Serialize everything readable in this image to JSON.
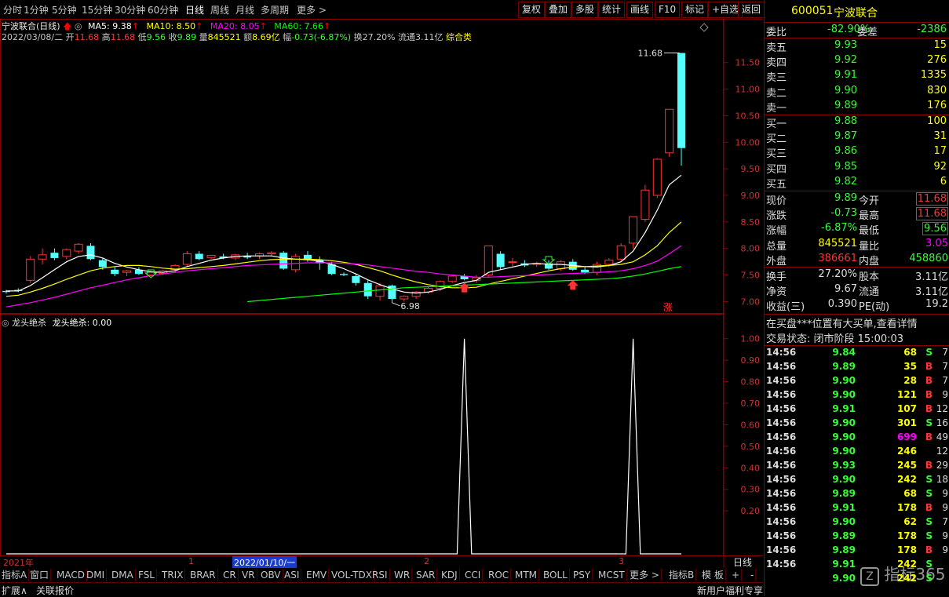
{
  "toolbar": {
    "periods": [
      "分时",
      "1分钟",
      "5分钟",
      "15分钟",
      "30分钟",
      "60分钟",
      "日线",
      "周线",
      "月线",
      "多周期",
      "更多 >"
    ],
    "active_period": "日线",
    "buttons": [
      "复权",
      "叠加",
      "多股",
      "统计",
      "画线",
      "F10",
      "标记",
      "+自选",
      "返回"
    ]
  },
  "header": {
    "stock_title": "宁波联合(日线)",
    "ma5": "MA5: 9.38",
    "ma10": "MA10: 8.50",
    "ma20": "MA20: 8.05",
    "ma60": "MA60: 7.66",
    "date": "2022/03/08/二",
    "open_label": "开",
    "open": "11.68",
    "high_label": "高",
    "high": "11.68",
    "low_label": "低",
    "low": "9.56",
    "close_label": "收",
    "close": "9.89",
    "vol_label": "量",
    "vol": "845521",
    "amt_label": "额",
    "amt": "8.69亿",
    "chg_label": "幅",
    "chg": "-0.73(-6.87%)",
    "turnover": "换27.20%",
    "float": "流通3.11亿",
    "category": "综合类"
  },
  "main_axis": [
    "11.50",
    "11.00",
    "10.50",
    "10.00",
    "9.50",
    "9.00",
    "8.50",
    "8.00",
    "7.50",
    "7.00"
  ],
  "annotations": {
    "high_label": "11.68",
    "low_label": "6.98",
    "zhang": "涨"
  },
  "indicator": {
    "title": "龙头绝杀",
    "value_text": "龙头绝杀: 0.00",
    "axis": [
      "1.00",
      "0.90",
      "0.80",
      "0.70",
      "0.60",
      "0.50",
      "0.40",
      "0.30",
      "0.20"
    ]
  },
  "timeline": {
    "year": "2021年",
    "m1": "1",
    "cursor_date": "2022/01/10/一",
    "m2": "2",
    "m3": "3",
    "period_btn": "日线"
  },
  "bottom_tabs": [
    "指标A",
    "窗口",
    "MACD",
    "DMI",
    "DMA",
    "FSL",
    "TRIX",
    "BRAR",
    "CR",
    "VR",
    "OBV",
    "ASI",
    "EMV",
    "VOL-TDX",
    "RSI",
    "WR",
    "SAR",
    "KDJ",
    "CCI",
    "ROC",
    "MTM",
    "BOLL",
    "PSY",
    "MCST",
    "更多 >"
  ],
  "bottom_right_tabs": [
    "指标B",
    "模 板",
    "+",
    "-"
  ],
  "status": {
    "expand": "扩展∧",
    "related": "关联报价",
    "promo": "新用户福利专享"
  },
  "right": {
    "code": "600051",
    "name": "宁波联合",
    "weibi_label": "委比",
    "weibi": "-82.90%",
    "weicha_label": "委差",
    "weicha": "-2386",
    "sell": [
      {
        "label": "卖五",
        "price": "9.93",
        "vol": "15"
      },
      {
        "label": "卖四",
        "price": "9.92",
        "vol": "276"
      },
      {
        "label": "卖三",
        "price": "9.91",
        "vol": "1335"
      },
      {
        "label": "卖二",
        "price": "9.90",
        "vol": "830"
      },
      {
        "label": "卖一",
        "price": "9.89",
        "vol": "176"
      }
    ],
    "buy": [
      {
        "label": "买一",
        "price": "9.88",
        "vol": "100"
      },
      {
        "label": "买二",
        "price": "9.87",
        "vol": "31"
      },
      {
        "label": "买三",
        "price": "9.86",
        "vol": "17"
      },
      {
        "label": "买四",
        "price": "9.85",
        "vol": "92"
      },
      {
        "label": "买五",
        "price": "9.82",
        "vol": "6"
      }
    ],
    "stats": [
      {
        "l1": "现价",
        "v1": "9.89",
        "l2": "今开",
        "v2": "11.68"
      },
      {
        "l1": "涨跌",
        "v1": "-0.73",
        "l2": "最高",
        "v2": "11.68"
      },
      {
        "l1": "涨幅",
        "v1": "-6.87%",
        "l2": "最低",
        "v2": "9.56"
      },
      {
        "l1": "总量",
        "v1": "845521",
        "l2": "量比",
        "v2": "3.05"
      },
      {
        "l1": "外盘",
        "v1": "386661",
        "l2": "内盘",
        "v2": "458860"
      }
    ],
    "stats2": [
      {
        "l1": "换手",
        "v1": "27.20%",
        "l2": "股本",
        "v2": "3.11亿"
      },
      {
        "l1": "净资",
        "v1": "9.67",
        "l2": "流通",
        "v2": "3.11亿"
      },
      {
        "l1": "收益(三)",
        "v1": "0.390",
        "l2": "PE(动)",
        "v2": "19.2"
      }
    ],
    "notice": "在买盘***位置有大买单,查看详情",
    "trade_state": "交易状态: 闭市阶段 15:00:03",
    "ticks": [
      {
        "t": "14:56",
        "p": "9.84",
        "v": "68",
        "bs": "S",
        "n": "7"
      },
      {
        "t": "14:56",
        "p": "9.89",
        "v": "35",
        "bs": "B",
        "n": "7"
      },
      {
        "t": "14:56",
        "p": "9.90",
        "v": "28",
        "bs": "B",
        "n": "7"
      },
      {
        "t": "14:56",
        "p": "9.90",
        "v": "121",
        "bs": "B",
        "n": "9"
      },
      {
        "t": "14:56",
        "p": "9.91",
        "v": "107",
        "bs": "B",
        "n": "12"
      },
      {
        "t": "14:56",
        "p": "9.90",
        "v": "301",
        "bs": "S",
        "n": "16"
      },
      {
        "t": "14:56",
        "p": "9.90",
        "v": "699",
        "bs": "B",
        "n": "49"
      },
      {
        "t": "14:56",
        "p": "9.90",
        "v": "246",
        "bs": "",
        "n": "12"
      },
      {
        "t": "14:56",
        "p": "9.93",
        "v": "245",
        "bs": "B",
        "n": "29"
      },
      {
        "t": "14:56",
        "p": "9.90",
        "v": "242",
        "bs": "S",
        "n": "18"
      },
      {
        "t": "14:56",
        "p": "9.89",
        "v": "68",
        "bs": "S",
        "n": "9"
      },
      {
        "t": "14:56",
        "p": "9.91",
        "v": "178",
        "bs": "B",
        "n": "9"
      },
      {
        "t": "14:56",
        "p": "9.90",
        "v": "62",
        "bs": "S",
        "n": "7"
      },
      {
        "t": "14:56",
        "p": "9.89",
        "v": "178",
        "bs": "S",
        "n": "9"
      },
      {
        "t": "14:56",
        "p": "9.89",
        "v": "178",
        "bs": "B",
        "n": "9"
      },
      {
        "t": "14:56",
        "p": "9.91",
        "v": "242",
        "bs": "S",
        "n": ""
      },
      {
        "t": "",
        "p": "9.90",
        "v": "242",
        "bs": "S",
        "n": ""
      }
    ],
    "watermark": "指标365"
  },
  "chart_data": {
    "type": "candlestick",
    "ylim": [
      6.8,
      11.85
    ],
    "candles": [
      [
        7.2,
        7.22,
        7.15,
        7.18
      ],
      [
        7.22,
        7.25,
        7.18,
        7.2
      ],
      [
        7.4,
        7.85,
        7.35,
        7.8
      ],
      [
        7.8,
        8.0,
        7.7,
        7.88
      ],
      [
        7.92,
        8.0,
        7.78,
        7.82
      ],
      [
        7.85,
        8.0,
        7.8,
        7.98
      ],
      [
        7.95,
        8.1,
        7.9,
        8.08
      ],
      [
        8.05,
        8.1,
        7.78,
        7.8
      ],
      [
        7.78,
        7.82,
        7.6,
        7.65
      ],
      [
        7.6,
        7.65,
        7.48,
        7.52
      ],
      [
        7.55,
        7.6,
        7.48,
        7.58
      ],
      [
        7.6,
        7.65,
        7.5,
        7.52
      ],
      [
        7.5,
        7.58,
        7.47,
        7.55
      ],
      [
        7.53,
        7.6,
        7.5,
        7.58
      ],
      [
        7.6,
        7.7,
        7.55,
        7.68
      ],
      [
        7.7,
        7.95,
        7.65,
        7.9
      ],
      [
        7.9,
        7.95,
        7.78,
        7.8
      ],
      [
        7.83,
        7.88,
        7.8,
        7.87
      ],
      [
        7.85,
        7.9,
        7.8,
        7.82
      ],
      [
        7.82,
        7.9,
        7.78,
        7.88
      ],
      [
        7.86,
        7.92,
        7.8,
        7.83
      ],
      [
        7.86,
        7.92,
        7.8,
        7.9
      ],
      [
        7.9,
        7.95,
        7.85,
        7.92
      ],
      [
        7.92,
        7.95,
        7.6,
        7.62
      ],
      [
        7.6,
        7.9,
        7.55,
        7.85
      ],
      [
        7.88,
        7.95,
        7.75,
        7.78
      ],
      [
        7.78,
        7.85,
        7.6,
        7.72
      ],
      [
        7.7,
        7.75,
        7.5,
        7.52
      ],
      [
        7.52,
        7.55,
        7.48,
        7.5
      ],
      [
        7.48,
        7.52,
        7.3,
        7.35
      ],
      [
        7.35,
        7.4,
        7.05,
        7.1
      ],
      [
        7.1,
        7.35,
        7.02,
        7.3
      ],
      [
        7.3,
        7.32,
        6.98,
        7.05
      ],
      [
        7.05,
        7.12,
        7.0,
        7.1
      ],
      [
        7.1,
        7.2,
        7.05,
        7.18
      ],
      [
        7.18,
        7.28,
        7.15,
        7.25
      ],
      [
        7.25,
        7.4,
        7.2,
        7.38
      ],
      [
        7.38,
        7.5,
        7.35,
        7.48
      ],
      [
        7.48,
        7.52,
        7.4,
        7.42
      ],
      [
        7.4,
        7.5,
        7.35,
        7.45
      ],
      [
        7.5,
        8.05,
        7.45,
        8.05
      ],
      [
        7.9,
        7.95,
        7.6,
        7.65
      ],
      [
        7.75,
        7.82,
        7.65,
        7.75
      ],
      [
        7.72,
        7.78,
        7.65,
        7.68
      ],
      [
        7.7,
        7.75,
        7.65,
        7.72
      ],
      [
        7.72,
        7.78,
        7.6,
        7.62
      ],
      [
        7.62,
        7.78,
        7.58,
        7.75
      ],
      [
        7.75,
        7.8,
        7.58,
        7.6
      ],
      [
        7.6,
        7.65,
        7.52,
        7.55
      ],
      [
        7.55,
        7.75,
        7.5,
        7.7
      ],
      [
        7.7,
        7.82,
        7.65,
        7.78
      ],
      [
        7.8,
        8.1,
        7.75,
        8.05
      ],
      [
        8.1,
        8.6,
        8.0,
        8.6
      ],
      [
        8.55,
        9.2,
        8.5,
        9.1
      ],
      [
        9.0,
        9.7,
        8.95,
        9.68
      ],
      [
        9.8,
        10.62,
        9.72,
        10.62
      ],
      [
        11.68,
        11.68,
        9.56,
        9.89
      ]
    ],
    "ma5": [
      7.2,
      7.2,
      7.3,
      7.45,
      7.6,
      7.75,
      7.85,
      7.88,
      7.82,
      7.72,
      7.65,
      7.6,
      7.56,
      7.55,
      7.58,
      7.66,
      7.72,
      7.78,
      7.82,
      7.85,
      7.86,
      7.86,
      7.86,
      7.82,
      7.8,
      7.79,
      7.76,
      7.7,
      7.62,
      7.52,
      7.41,
      7.32,
      7.24,
      7.18,
      7.16,
      7.18,
      7.23,
      7.3,
      7.36,
      7.4,
      7.55,
      7.6,
      7.65,
      7.7,
      7.72,
      7.7,
      7.7,
      7.68,
      7.66,
      7.65,
      7.68,
      7.75,
      7.95,
      8.3,
      8.72,
      9.2,
      9.38
    ],
    "ma10": [
      7.1,
      7.12,
      7.18,
      7.25,
      7.33,
      7.42,
      7.5,
      7.58,
      7.63,
      7.66,
      7.68,
      7.68,
      7.66,
      7.63,
      7.61,
      7.62,
      7.64,
      7.66,
      7.68,
      7.71,
      7.74,
      7.77,
      7.79,
      7.8,
      7.8,
      7.8,
      7.79,
      7.77,
      7.74,
      7.7,
      7.64,
      7.58,
      7.5,
      7.43,
      7.37,
      7.32,
      7.28,
      7.26,
      7.26,
      7.27,
      7.33,
      7.38,
      7.43,
      7.48,
      7.53,
      7.58,
      7.62,
      7.65,
      7.66,
      7.67,
      7.68,
      7.7,
      7.75,
      7.88,
      8.05,
      8.3,
      8.5
    ],
    "ma20": [
      6.9,
      6.94,
      6.98,
      7.03,
      7.08,
      7.14,
      7.2,
      7.26,
      7.31,
      7.36,
      7.41,
      7.45,
      7.49,
      7.52,
      7.55,
      7.58,
      7.6,
      7.62,
      7.64,
      7.66,
      7.68,
      7.69,
      7.7,
      7.71,
      7.72,
      7.73,
      7.73,
      7.73,
      7.72,
      7.71,
      7.69,
      7.66,
      7.63,
      7.6,
      7.57,
      7.55,
      7.52,
      7.5,
      7.48,
      7.46,
      7.46,
      7.47,
      7.48,
      7.49,
      7.5,
      7.51,
      7.52,
      7.53,
      7.54,
      7.55,
      7.56,
      7.58,
      7.62,
      7.68,
      7.76,
      7.9,
      8.05
    ],
    "ma60_start": 20,
    "ma60": [
      7.0,
      7.02,
      7.04,
      7.06,
      7.08,
      7.1,
      7.12,
      7.14,
      7.16,
      7.18,
      7.2,
      7.22,
      7.24,
      7.26,
      7.27,
      7.28,
      7.29,
      7.3,
      7.31,
      7.32,
      7.33,
      7.34,
      7.35,
      7.36,
      7.37,
      7.38,
      7.39,
      7.4,
      7.41,
      7.42,
      7.43,
      7.45,
      7.48,
      7.52,
      7.57,
      7.62,
      7.66
    ],
    "indicator_spikes": [
      {
        "index": 38,
        "value": 1.0
      },
      {
        "index": 52,
        "value": 1.0
      }
    ],
    "indicator_ylim": [
      0,
      1.05
    ]
  }
}
